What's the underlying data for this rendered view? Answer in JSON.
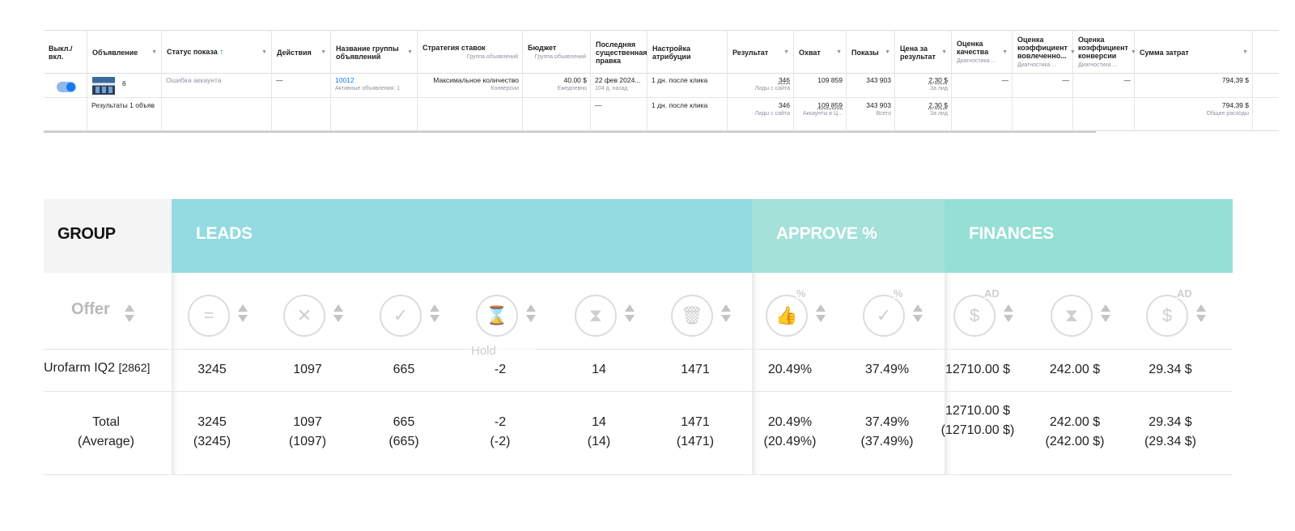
{
  "ads_table": {
    "headers": [
      {
        "label": "Выкл./вкл.",
        "sub": ""
      },
      {
        "label": "Объявление",
        "sub": ""
      },
      {
        "label": "Статус показа",
        "sub": ""
      },
      {
        "label": "Действия",
        "sub": ""
      },
      {
        "label": "Название группы объявлений",
        "sub": ""
      },
      {
        "label": "Стратегия ставок",
        "sub": "Группа объявлений"
      },
      {
        "label": "Бюджет",
        "sub": "Группа объявлений"
      },
      {
        "label": "Последняя существенная правка",
        "sub": ""
      },
      {
        "label": "Настройка атрибуции",
        "sub": ""
      },
      {
        "label": "Результат",
        "sub": ""
      },
      {
        "label": "Охват",
        "sub": ""
      },
      {
        "label": "Показы",
        "sub": ""
      },
      {
        "label": "Цена за результат",
        "sub": ""
      },
      {
        "label": "Оценка качества",
        "sub": "Диагностика ..."
      },
      {
        "label": "Оценка коэффициент вовлеченно...",
        "sub": "Диагностика ..."
      },
      {
        "label": "Оценка коэффициент конверсии",
        "sub": "Диагностика ..."
      },
      {
        "label": "Сумма затрат",
        "sub": ""
      }
    ],
    "row": {
      "ad_count": "6",
      "status": "Ошибка аккаунта",
      "actions": "—",
      "adset_name": "10012",
      "adset_sub": "Активные объявления: 1",
      "bid_strategy": "Максимальное количество",
      "bid_sub": "Конверсии",
      "budget": "40.00 $",
      "budget_sub": "Ежедневно",
      "last_edit": "22 фев 2024...",
      "last_edit_sub": "104 д. назад",
      "attribution": "1 дн. после клика",
      "result": "346",
      "result_sub": "Лиды с сайта",
      "reach": "109 859",
      "impressions": "343 903",
      "cpr": "2,30 $",
      "cpr_sub": "За лид",
      "quality": "—",
      "engagement": "—",
      "conversion": "—",
      "spend": "794,39 $"
    },
    "summary": {
      "label": "Результаты 1 объяв",
      "last_edit": "—",
      "attribution": "1 дн. после клика",
      "result": "346",
      "result_sub": "Лиды с сайта",
      "reach": "109 859",
      "reach_sub": "Аккаунты в Ц...",
      "impressions": "343 903",
      "impressions_sub": "Всего",
      "cpr": "2,30 $",
      "cpr_sub": "За лид",
      "spend": "794,39 $",
      "spend_sub": "Общие расходы"
    },
    "colors": {
      "accent": "#1877f2",
      "toggle_track": "#8fb9ea"
    }
  },
  "stats": {
    "group_label": "GROUP",
    "sections": [
      "LEADS",
      "APPROVE %",
      "FINANCES"
    ],
    "offer_label": "Offer",
    "column_icons": [
      {
        "name": "equals-icon",
        "glyph": "="
      },
      {
        "name": "cross-icon",
        "glyph": "✕"
      },
      {
        "name": "check-icon",
        "glyph": "✓"
      },
      {
        "name": "hourglass-crossed-icon",
        "glyph": "⌛"
      },
      {
        "name": "hourglass-icon",
        "glyph": "⧗"
      },
      {
        "name": "trash-icon",
        "glyph": "🗑"
      },
      {
        "name": "thumb-percent-icon",
        "glyph": "👍",
        "badge": "%"
      },
      {
        "name": "check-percent-icon",
        "glyph": "✓",
        "badge": "%"
      },
      {
        "name": "dollar-ad-icon",
        "glyph": "$",
        "badge": "AD"
      },
      {
        "name": "hourglass-money-icon",
        "glyph": "⧗"
      },
      {
        "name": "dollar-ad-icon",
        "glyph": "$",
        "badge": "AD"
      }
    ],
    "tooltip": "Hold",
    "rows": [
      {
        "label": "Urofarm IQ2",
        "id": "[2862]",
        "values": [
          "3245",
          "1097",
          "665",
          "-2",
          "14",
          "1471",
          "20.49%",
          "37.49%",
          "12710.00 $",
          "242.00 $",
          "29.34 $"
        ]
      }
    ],
    "total": {
      "label": "Total",
      "label2": "(Average)",
      "values": [
        "3245",
        "1097",
        "665",
        "-2",
        "14",
        "1471",
        "20.49%",
        "37.49%",
        "12710.00 $",
        "242.00 $",
        "29.34 $"
      ],
      "averages": [
        "(3245)",
        "(1097)",
        "(665)",
        "(-2)",
        "(14)",
        "(1471)",
        "(20.49%)",
        "(37.49%)",
        "(12710.00 $)",
        "(242.00 $)",
        "(29.34 $)"
      ]
    },
    "colors": {
      "leads": "#93dbe0",
      "approve": "#a3e1d9",
      "finances": "#95dfd4",
      "group": "#f4f4f4"
    }
  }
}
